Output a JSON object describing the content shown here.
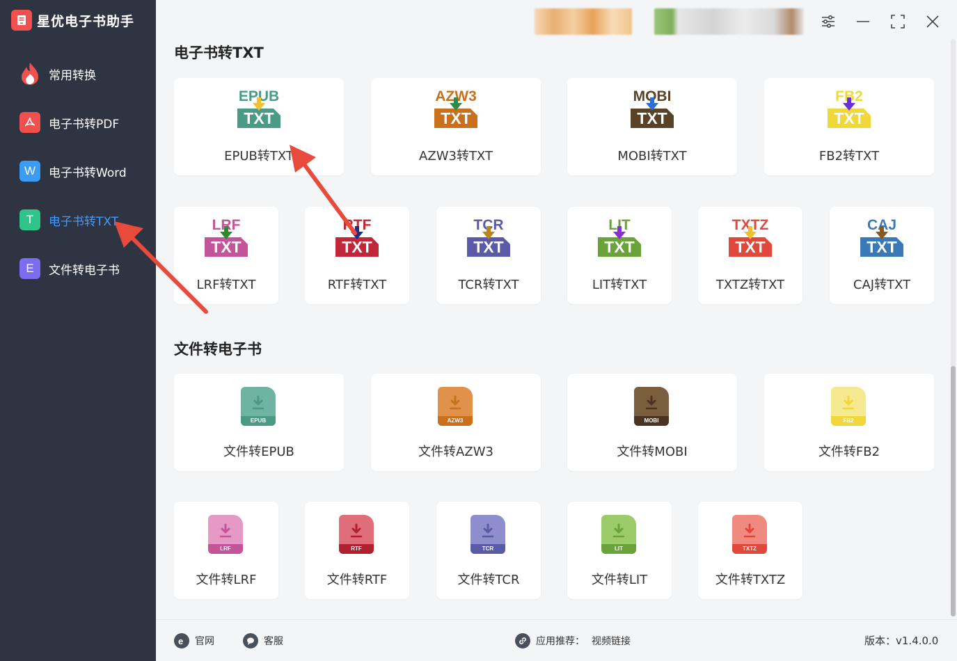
{
  "app": {
    "title": "星优电子书助手"
  },
  "sidebar": {
    "items": [
      {
        "label": "常用转换",
        "icon": "fire-icon",
        "color": "#f0514f"
      },
      {
        "label": "电子书转PDF",
        "icon": "pdf-icon",
        "color": "#f0514f"
      },
      {
        "label": "电子书转Word",
        "icon": "word-icon",
        "color": "#3b9cf2",
        "glyph": "W"
      },
      {
        "label": "电子书转TXT",
        "icon": "txt-icon",
        "color": "#2fc48a",
        "glyph": "T",
        "active": true
      },
      {
        "label": "文件转电子书",
        "icon": "ebook-icon",
        "color": "#7b6cf0",
        "glyph": "E"
      }
    ]
  },
  "window_controls": [
    "settings-sliders-icon",
    "minimize-icon",
    "maximize-icon",
    "close-icon"
  ],
  "sections": {
    "to_txt": {
      "title": "电子书转TXT",
      "cards": [
        {
          "format": "EPUB",
          "label": "EPUB转TXT",
          "fmt_color": "#4a9a86",
          "txt_color": "#4a9a86",
          "arrow_color": "#f2c12e"
        },
        {
          "format": "AZW3",
          "label": "AZW3转TXT",
          "fmt_color": "#c9701d",
          "txt_color": "#c9701d",
          "arrow_color": "#2e8a4a"
        },
        {
          "format": "MOBI",
          "label": "MOBI转TXT",
          "fmt_color": "#5a4226",
          "txt_color": "#5a4226",
          "arrow_color": "#2a6ed6"
        },
        {
          "format": "FB2",
          "label": "FB2转TXT",
          "fmt_color": "#f1d83a",
          "txt_color": "#f1d83a",
          "arrow_color": "#6a2fd6"
        },
        {
          "format": "LRF",
          "label": "LRF转TXT",
          "fmt_color": "#c4549a",
          "txt_color": "#c4549a",
          "arrow_color": "#2e8a2e"
        },
        {
          "format": "RTF",
          "label": "RTF转TXT",
          "fmt_color": "#c0283a",
          "txt_color": "#c0283a",
          "arrow_color": "#1f2a8c"
        },
        {
          "format": "TCR",
          "label": "TCR转TXT",
          "fmt_color": "#5a5aa6",
          "txt_color": "#5a5aa6",
          "arrow_color": "#b8861a"
        },
        {
          "format": "LIT",
          "label": "LIT转TXT",
          "fmt_color": "#6aa33a",
          "txt_color": "#6aa33a",
          "arrow_color": "#8a2fd6"
        },
        {
          "format": "TXTZ",
          "label": "TXTZ转TXT",
          "fmt_color": "#e0483c",
          "txt_color": "#e0483c",
          "arrow_color": "#f2c12e"
        },
        {
          "format": "CAJ",
          "label": "CAJ转TXT",
          "fmt_color": "#3a78b8",
          "txt_color": "#3a78b8",
          "arrow_color": "#8a5a1a"
        }
      ]
    },
    "to_ebook": {
      "title": "文件转电子书",
      "cards": [
        {
          "format": "EPUB",
          "label": "文件转EPUB",
          "color": "#6fb3a2",
          "tag_color": "#4a9a86"
        },
        {
          "format": "AZW3",
          "label": "文件转AZW3",
          "color": "#e0924a",
          "tag_color": "#c9701d"
        },
        {
          "format": "MOBI",
          "label": "文件转MOBI",
          "color": "#7a5e3e",
          "tag_color": "#4a3420"
        },
        {
          "format": "FB2",
          "label": "文件转FB2",
          "color": "#f6ea90",
          "tag_color": "#f1d83a"
        },
        {
          "format": "LRF",
          "label": "文件转LRF",
          "color": "#e59ac5",
          "tag_color": "#c4549a"
        },
        {
          "format": "RTF",
          "label": "文件转RTF",
          "color": "#e06e7a",
          "tag_color": "#b0202e"
        },
        {
          "format": "TCR",
          "label": "文件转TCR",
          "color": "#8e8ecc",
          "tag_color": "#5a5aa6"
        },
        {
          "format": "LIT",
          "label": "文件转LIT",
          "color": "#9ccb6a",
          "tag_color": "#6aa33a"
        },
        {
          "format": "TXTZ",
          "label": "文件转TXTZ",
          "color": "#f08a80",
          "tag_color": "#e0483c"
        }
      ]
    }
  },
  "footer": {
    "website": "官网",
    "support": "客服",
    "recommend": "应用推荐：",
    "recommend_link": "视频链接",
    "version": "版本：v1.4.0.0"
  },
  "annotation_color": "#e84a3c"
}
